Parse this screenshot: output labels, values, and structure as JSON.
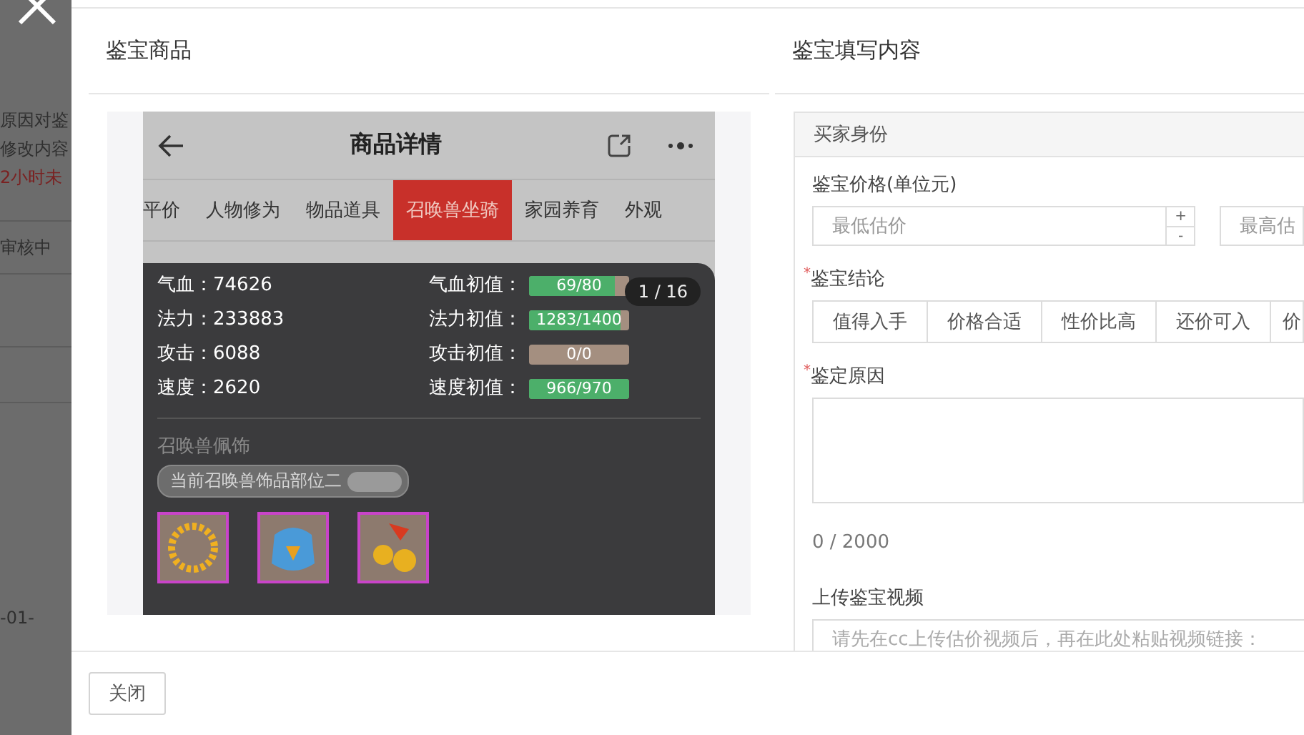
{
  "background": {
    "texts": [
      {
        "text": "原因对鉴",
        "kind": "normal"
      },
      {
        "text": "修改内容",
        "kind": "normal"
      },
      {
        "text": "2小时未",
        "kind": "warning"
      },
      {
        "text": "审核中",
        "kind": "normal"
      },
      {
        "text": "-01-",
        "kind": "normal"
      }
    ]
  },
  "goods_panel": {
    "title": "鉴宝商品",
    "phone": {
      "title": "商品详情",
      "tabs": [
        {
          "label": "平价",
          "selected": false
        },
        {
          "label": "人物修为",
          "selected": false
        },
        {
          "label": "物品道具",
          "selected": false
        },
        {
          "label": "召唤兽坐骑",
          "selected": true
        },
        {
          "label": "家园养育",
          "selected": false
        },
        {
          "label": "外观",
          "selected": false
        }
      ],
      "stats": [
        {
          "text": "气血：74626"
        },
        {
          "text": "法力：233883"
        },
        {
          "text": "攻击：6088"
        },
        {
          "text": "速度：2620"
        }
      ],
      "initial_values": [
        {
          "label": "气血初值：",
          "reading": "69/80",
          "level": 0.86
        },
        {
          "label": "法力初值：",
          "reading": "1283/1400",
          "level": 0.92
        },
        {
          "label": "攻击初值：",
          "reading": "0/0"
        },
        {
          "label": "速度初值：",
          "reading": "966/970",
          "level": 1
        }
      ],
      "page_badge": "1 / 16",
      "accessories": {
        "title": "召唤兽佩饰",
        "slot_label": "当前召唤兽饰品部位二",
        "items": [
          {
            "kind": "bracelet"
          },
          {
            "kind": "armor"
          },
          {
            "kind": "bells"
          }
        ]
      }
    }
  },
  "form_panel": {
    "title": "鉴宝填写内容",
    "section": "买家身份",
    "price": {
      "label": "鉴宝价格(单位元)",
      "min_placeholder": "最低估价",
      "plus": "+",
      "minus": "-",
      "max_placeholder": "最高估"
    },
    "conclusion": {
      "required_mark": "*",
      "label": "鉴宝结论",
      "options": [
        {
          "label": "值得入手",
          "selected": false
        },
        {
          "label": "价格合适",
          "selected": false
        },
        {
          "label": "性价比高",
          "selected": false
        },
        {
          "label": "还价可入",
          "selected": false
        },
        {
          "label": "价",
          "selected": false
        }
      ]
    },
    "reason": {
      "required_mark": "*",
      "label": "鉴定原因",
      "counter": "0 / 2000"
    },
    "video": {
      "label": "上传鉴宝视频",
      "placeholder": "请先在cc上传估价视频后，再在此处粘贴视频链接："
    }
  },
  "footer": {
    "close_button": "关闭"
  }
}
